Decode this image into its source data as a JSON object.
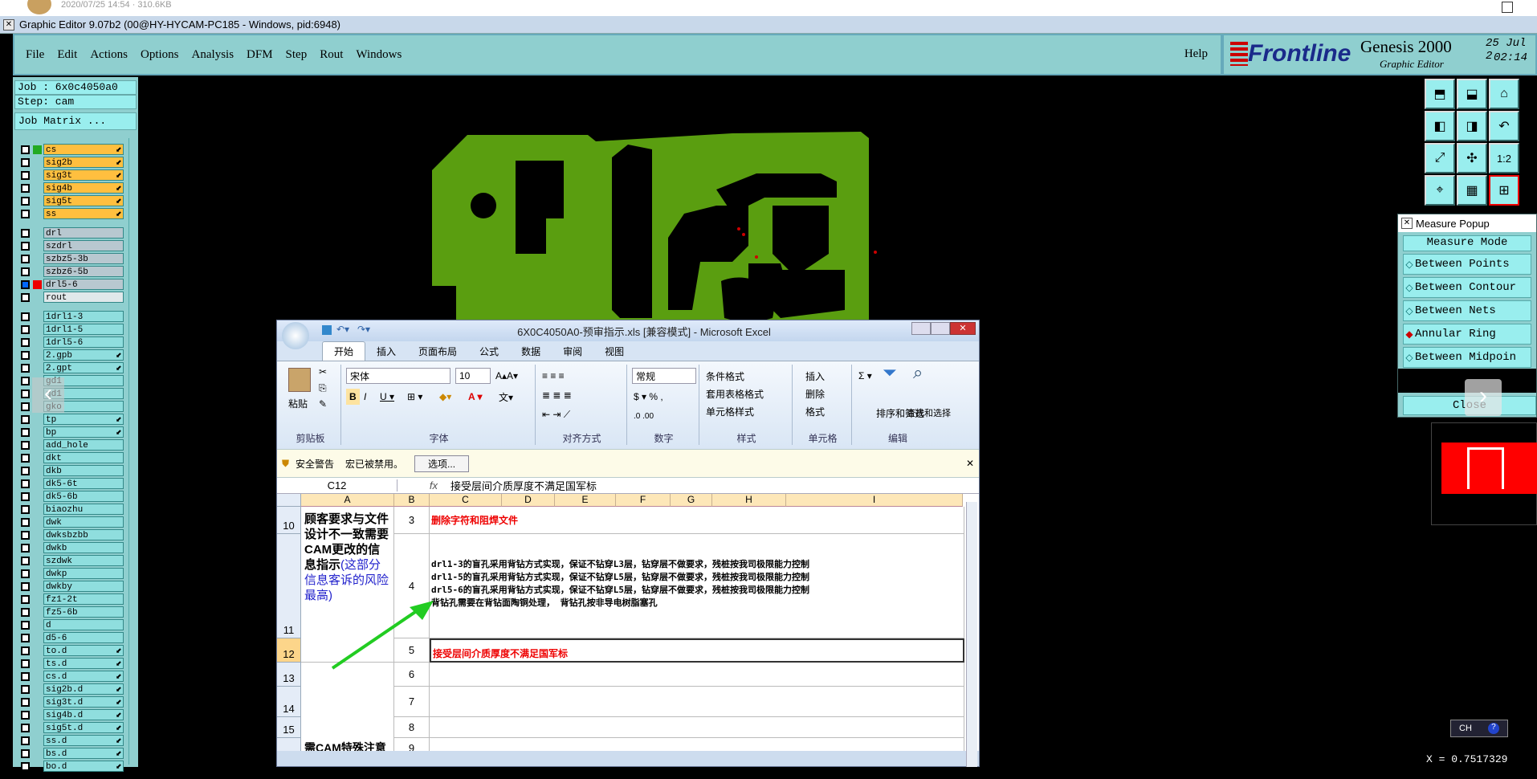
{
  "top_strip": {
    "timestamp": "2020/07/25 14:54 · 310.6KB"
  },
  "app": {
    "title": "Graphic Editor 9.07b2 (00@HY-HYCAM-PC185 - Windows, pid:6948)",
    "menu": [
      "File",
      "Edit",
      "Actions",
      "Options",
      "Analysis",
      "DFM",
      "Step",
      "Rout",
      "Windows"
    ],
    "help": "Help",
    "brand": "Frontline",
    "product": "Genesis 2000",
    "product_sub": "Graphic Editor",
    "date": "25 Jul 2",
    "time": "02:14"
  },
  "left": {
    "job": "Job : 6x0c4050a0",
    "step": "Step: cam",
    "job_matrix": "Job Matrix ...",
    "layers_top": [
      "cs",
      "sig2b",
      "sig3t",
      "sig4b",
      "sig5t",
      "ss"
    ],
    "layers_mid": [
      "drl",
      "szdrl",
      "szbz5-3b",
      "szbz6-5b",
      "drl5-6",
      "rout"
    ],
    "layers_bot": [
      "1drl1-3",
      "1drl1-5",
      "1drl5-6",
      "2.gpb",
      "2.gpt",
      "gd1",
      "gd1",
      "gko",
      "tp",
      "bp",
      "add_hole",
      "dkt",
      "dkb",
      "dk5-6t",
      "dk5-6b",
      "biaozhu",
      "dwk",
      "dwksbzbb",
      "dwkb",
      "szdwk",
      "dwkp",
      "dwkby",
      "fz1-2t",
      "fz5-6b",
      "d",
      "d5-6",
      "to.d",
      "ts.d",
      "cs.d",
      "sig2b.d",
      "sig3t.d",
      "sig4b.d",
      "sig5t.d",
      "ss.d",
      "bs.d",
      "bo.d"
    ]
  },
  "measure": {
    "title": "Measure Popup",
    "mode": "Measure Mode",
    "items": [
      "Between Points",
      "Between Contour",
      "Between Nets",
      "Annular Ring",
      "Between Midpoin"
    ],
    "close": "Close"
  },
  "toolbar_icons": [
    "up-icon",
    "down-icon",
    "home-icon",
    "left-icon",
    "right-icon",
    "undo-icon",
    "fit-icon",
    "center-icon",
    "ratio-icon",
    "measure-icon",
    "grid-icon",
    "snap-icon"
  ],
  "ratio_label": "1:2",
  "bottom_right": {
    "ch": "CH",
    "coord": "X = 0.7517329"
  },
  "excel": {
    "title": "6X0C4050A0-预审指示.xls [兼容模式] - Microsoft Excel",
    "tabs": [
      "开始",
      "插入",
      "页面布局",
      "公式",
      "数据",
      "审阅",
      "视图"
    ],
    "groups": [
      "剪贴板",
      "字体",
      "对齐方式",
      "数字",
      "样式",
      "单元格",
      "编辑"
    ],
    "paste": "粘贴",
    "font": "宋体",
    "size": "10",
    "number_format": "常规",
    "styles": [
      "条件格式",
      "套用表格格式",
      "单元格样式"
    ],
    "cells_ops": [
      "插入",
      "删除",
      "格式"
    ],
    "edit_ops": [
      "排序和筛选",
      "查找和选择"
    ],
    "security": "安全警告",
    "macro_msg": "宏已被禁用。",
    "options_btn": "选项...",
    "cell_ref": "C12",
    "formula": "接受层间介质厚度不满足国军标",
    "columns": [
      "A",
      "B",
      "C",
      "D",
      "E",
      "F",
      "G",
      "H",
      "I"
    ],
    "rows": [
      {
        "num": "10",
        "b": "3",
        "c": [
          "删除字符和阻焊文件"
        ]
      },
      {
        "num": "11",
        "b": "4",
        "c": [
          "drl1-3的盲孔采用背钻方式实现，保证不钻穿L3层，钻穿层不做要求，残桩按我司极限能力控制",
          "drl1-5的盲孔采用背钻方式实现，保证不钻穿L5层，钻穿层不做要求，残桩按我司极限能力控制",
          "drl5-6的盲孔采用背钻方式实现，保证不钻穿L5层，钻穿层不做要求，残桩按我司极限能力控制",
          "背钻孔需要在背钻面陶铜处理， 背钻孔按非导电树脂塞孔"
        ]
      },
      {
        "num": "12",
        "b": "5",
        "c": [
          "接受层间介质厚度不满足国军标"
        ]
      },
      {
        "num": "13",
        "b": "6",
        "c": []
      },
      {
        "num": "14",
        "b": "7",
        "c": []
      },
      {
        "num": "15",
        "b": "8",
        "c": []
      },
      {
        "num": "",
        "b": "9",
        "c": []
      }
    ],
    "a_block1": "顾客要求与文件设计不一致需要CAM更改的信息指示",
    "a_block1_blue": "(这部分信息客诉的风险最高)",
    "a_block2": "需CAM特殊注意或者补充说"
  }
}
